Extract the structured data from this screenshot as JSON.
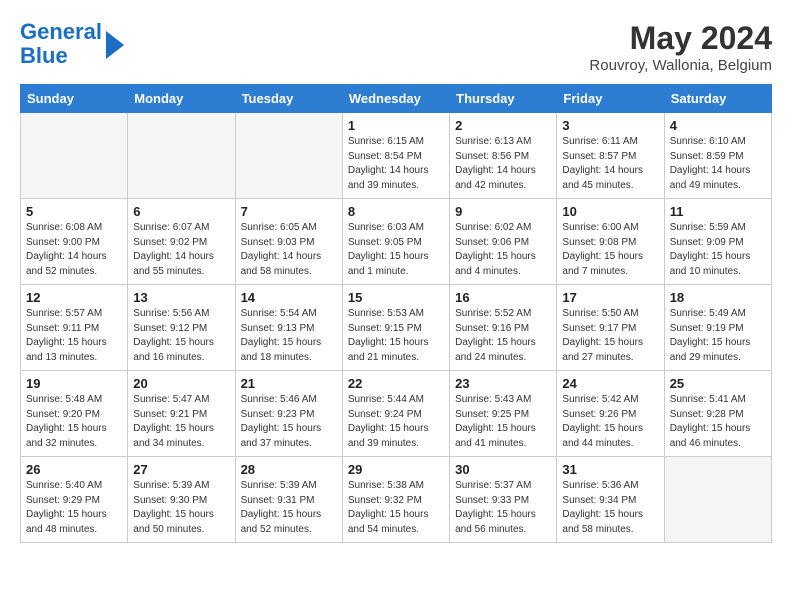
{
  "header": {
    "logo_line1": "General",
    "logo_line2": "Blue",
    "month_title": "May 2024",
    "location": "Rouvroy, Wallonia, Belgium"
  },
  "columns": [
    "Sunday",
    "Monday",
    "Tuesday",
    "Wednesday",
    "Thursday",
    "Friday",
    "Saturday"
  ],
  "weeks": [
    [
      {
        "day": "",
        "info": ""
      },
      {
        "day": "",
        "info": ""
      },
      {
        "day": "",
        "info": ""
      },
      {
        "day": "1",
        "info": "Sunrise: 6:15 AM\nSunset: 8:54 PM\nDaylight: 14 hours\nand 39 minutes."
      },
      {
        "day": "2",
        "info": "Sunrise: 6:13 AM\nSunset: 8:56 PM\nDaylight: 14 hours\nand 42 minutes."
      },
      {
        "day": "3",
        "info": "Sunrise: 6:11 AM\nSunset: 8:57 PM\nDaylight: 14 hours\nand 45 minutes."
      },
      {
        "day": "4",
        "info": "Sunrise: 6:10 AM\nSunset: 8:59 PM\nDaylight: 14 hours\nand 49 minutes."
      }
    ],
    [
      {
        "day": "5",
        "info": "Sunrise: 6:08 AM\nSunset: 9:00 PM\nDaylight: 14 hours\nand 52 minutes."
      },
      {
        "day": "6",
        "info": "Sunrise: 6:07 AM\nSunset: 9:02 PM\nDaylight: 14 hours\nand 55 minutes."
      },
      {
        "day": "7",
        "info": "Sunrise: 6:05 AM\nSunset: 9:03 PM\nDaylight: 14 hours\nand 58 minutes."
      },
      {
        "day": "8",
        "info": "Sunrise: 6:03 AM\nSunset: 9:05 PM\nDaylight: 15 hours\nand 1 minute."
      },
      {
        "day": "9",
        "info": "Sunrise: 6:02 AM\nSunset: 9:06 PM\nDaylight: 15 hours\nand 4 minutes."
      },
      {
        "day": "10",
        "info": "Sunrise: 6:00 AM\nSunset: 9:08 PM\nDaylight: 15 hours\nand 7 minutes."
      },
      {
        "day": "11",
        "info": "Sunrise: 5:59 AM\nSunset: 9:09 PM\nDaylight: 15 hours\nand 10 minutes."
      }
    ],
    [
      {
        "day": "12",
        "info": "Sunrise: 5:57 AM\nSunset: 9:11 PM\nDaylight: 15 hours\nand 13 minutes."
      },
      {
        "day": "13",
        "info": "Sunrise: 5:56 AM\nSunset: 9:12 PM\nDaylight: 15 hours\nand 16 minutes."
      },
      {
        "day": "14",
        "info": "Sunrise: 5:54 AM\nSunset: 9:13 PM\nDaylight: 15 hours\nand 18 minutes."
      },
      {
        "day": "15",
        "info": "Sunrise: 5:53 AM\nSunset: 9:15 PM\nDaylight: 15 hours\nand 21 minutes."
      },
      {
        "day": "16",
        "info": "Sunrise: 5:52 AM\nSunset: 9:16 PM\nDaylight: 15 hours\nand 24 minutes."
      },
      {
        "day": "17",
        "info": "Sunrise: 5:50 AM\nSunset: 9:17 PM\nDaylight: 15 hours\nand 27 minutes."
      },
      {
        "day": "18",
        "info": "Sunrise: 5:49 AM\nSunset: 9:19 PM\nDaylight: 15 hours\nand 29 minutes."
      }
    ],
    [
      {
        "day": "19",
        "info": "Sunrise: 5:48 AM\nSunset: 9:20 PM\nDaylight: 15 hours\nand 32 minutes."
      },
      {
        "day": "20",
        "info": "Sunrise: 5:47 AM\nSunset: 9:21 PM\nDaylight: 15 hours\nand 34 minutes."
      },
      {
        "day": "21",
        "info": "Sunrise: 5:46 AM\nSunset: 9:23 PM\nDaylight: 15 hours\nand 37 minutes."
      },
      {
        "day": "22",
        "info": "Sunrise: 5:44 AM\nSunset: 9:24 PM\nDaylight: 15 hours\nand 39 minutes."
      },
      {
        "day": "23",
        "info": "Sunrise: 5:43 AM\nSunset: 9:25 PM\nDaylight: 15 hours\nand 41 minutes."
      },
      {
        "day": "24",
        "info": "Sunrise: 5:42 AM\nSunset: 9:26 PM\nDaylight: 15 hours\nand 44 minutes."
      },
      {
        "day": "25",
        "info": "Sunrise: 5:41 AM\nSunset: 9:28 PM\nDaylight: 15 hours\nand 46 minutes."
      }
    ],
    [
      {
        "day": "26",
        "info": "Sunrise: 5:40 AM\nSunset: 9:29 PM\nDaylight: 15 hours\nand 48 minutes."
      },
      {
        "day": "27",
        "info": "Sunrise: 5:39 AM\nSunset: 9:30 PM\nDaylight: 15 hours\nand 50 minutes."
      },
      {
        "day": "28",
        "info": "Sunrise: 5:39 AM\nSunset: 9:31 PM\nDaylight: 15 hours\nand 52 minutes."
      },
      {
        "day": "29",
        "info": "Sunrise: 5:38 AM\nSunset: 9:32 PM\nDaylight: 15 hours\nand 54 minutes."
      },
      {
        "day": "30",
        "info": "Sunrise: 5:37 AM\nSunset: 9:33 PM\nDaylight: 15 hours\nand 56 minutes."
      },
      {
        "day": "31",
        "info": "Sunrise: 5:36 AM\nSunset: 9:34 PM\nDaylight: 15 hours\nand 58 minutes."
      },
      {
        "day": "",
        "info": ""
      }
    ]
  ]
}
